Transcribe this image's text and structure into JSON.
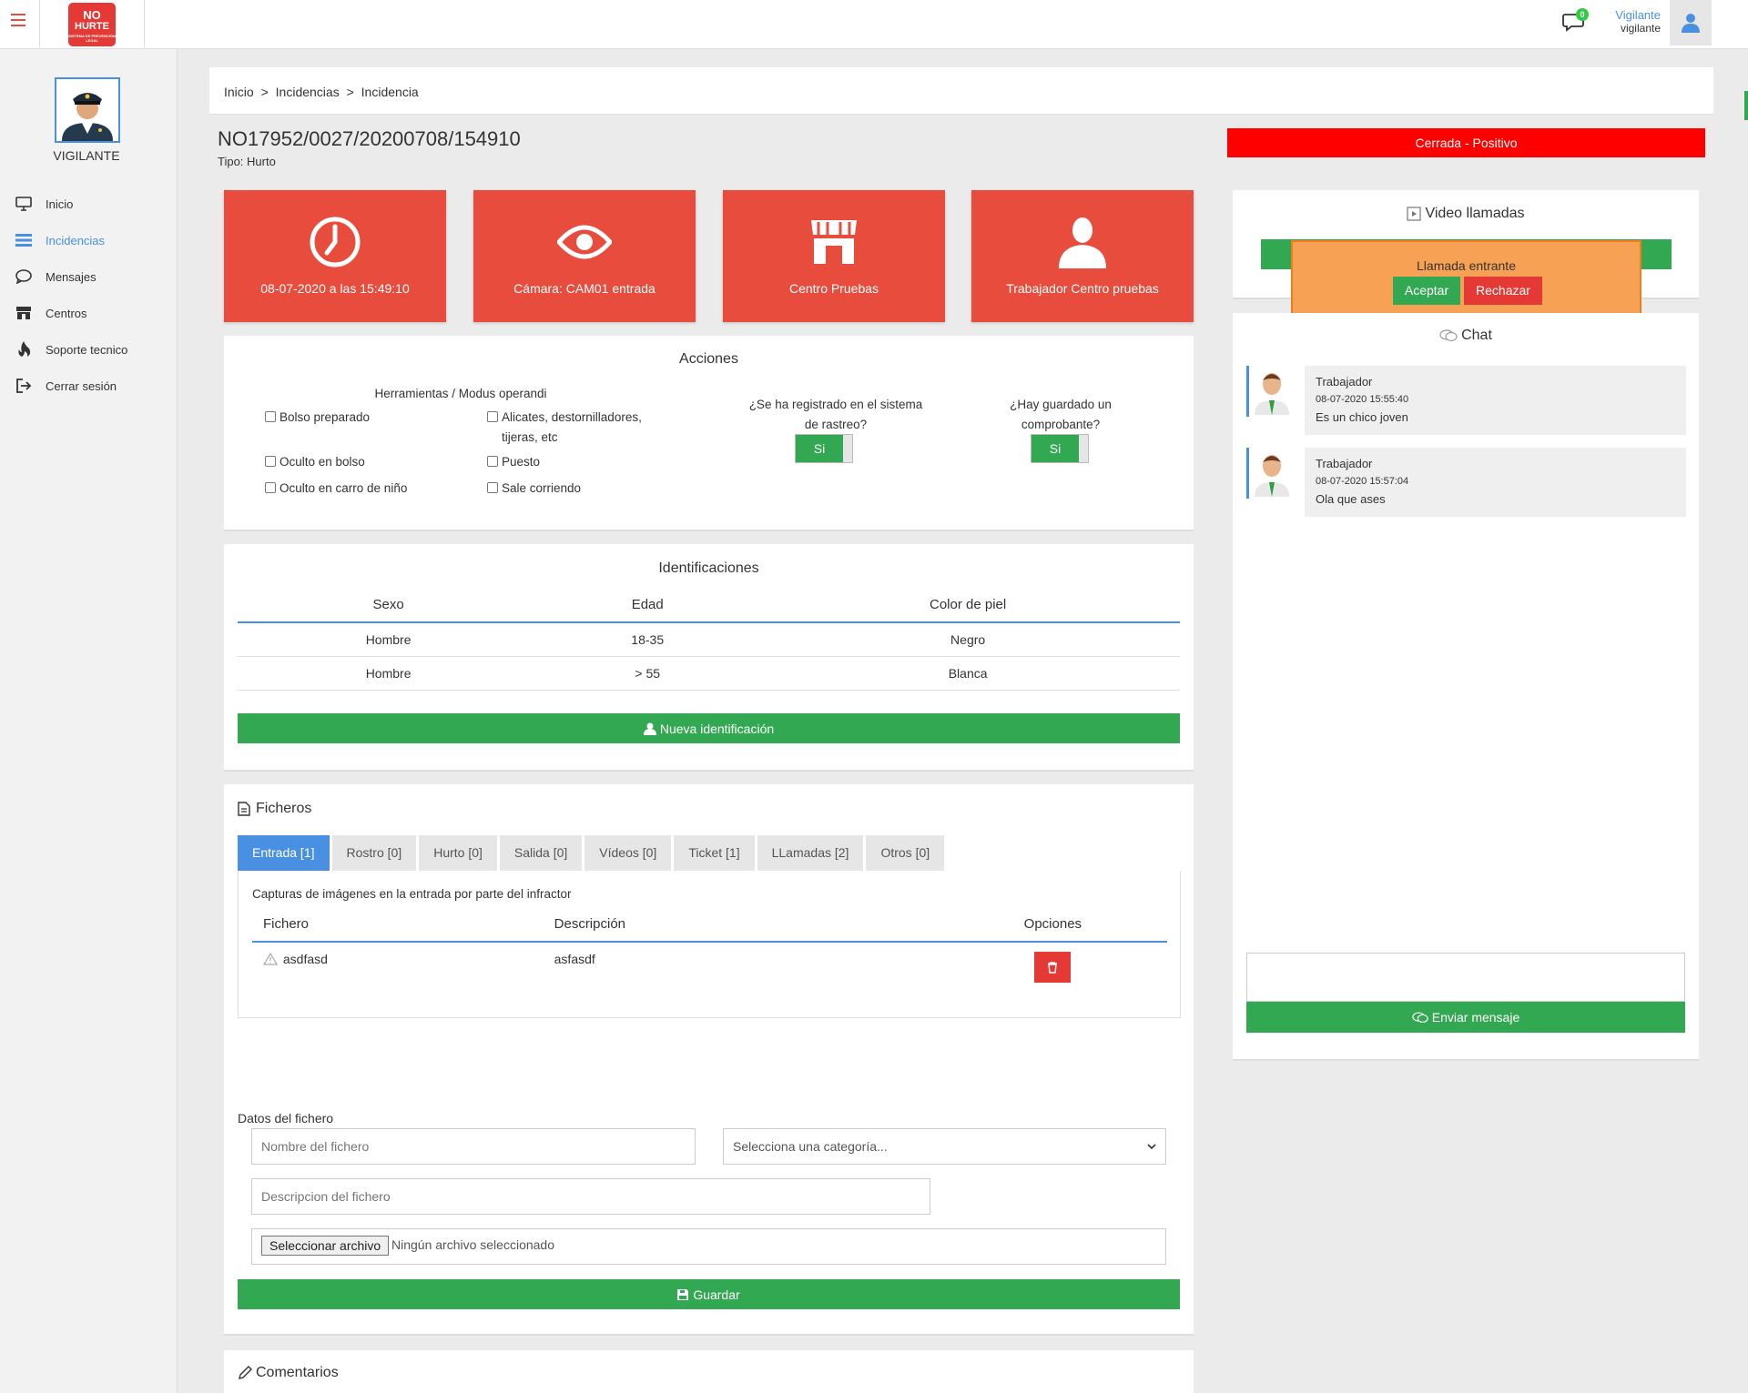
{
  "header": {
    "logo_top": "NO",
    "logo_main": "HURTE",
    "logo_sub": "SISTEMA DE PREVENCIÓN LEGAL",
    "notifications": "0",
    "user_name": "Vigilante",
    "user_role": "vigilante"
  },
  "sidebar": {
    "profile_label": "VIGILANTE",
    "items": [
      {
        "label": "Inicio",
        "icon": "monitor-icon"
      },
      {
        "label": "Incidencias",
        "icon": "list-icon"
      },
      {
        "label": "Mensajes",
        "icon": "message-icon"
      },
      {
        "label": "Centros",
        "icon": "store-icon"
      },
      {
        "label": "Soporte tecnico",
        "icon": "flame-icon"
      },
      {
        "label": "Cerrar sesión",
        "icon": "logout-icon"
      }
    ]
  },
  "breadcrumb": {
    "items": [
      "Inicio",
      "Incidencias",
      "Incidencia"
    ],
    "sep": ">"
  },
  "incident": {
    "code": "NO17952/0027/20200708/154910",
    "type": "Tipo: Hurto",
    "status": "Cerrada - Positivo",
    "status_color": "#ff0000"
  },
  "tiles": [
    {
      "label": "08-07-2020 a las 15:49:10",
      "icon": "clock-icon"
    },
    {
      "label": "Cámara: CAM01 entrada",
      "icon": "eye-icon"
    },
    {
      "label": "Centro Pruebas",
      "icon": "store-icon"
    },
    {
      "label": "Trabajador Centro pruebas",
      "icon": "person-icon"
    }
  ],
  "acciones": {
    "title": "Acciones",
    "tools_title": "Herramientas / Modus operandi",
    "checks": [
      "Bolso preparado",
      "Alicates, destornilladores, tijeras, etc",
      "Oculto en bolso",
      "Puesto",
      "Oculto en carro de niño",
      "Sale corriendo"
    ],
    "q1": "¿Se ha registrado en el sistema de rastreo?",
    "q1_value": "Si",
    "q2": "¿Hay guardado un comprobante?",
    "q2_value": "Si"
  },
  "identificaciones": {
    "title": "Identificaciones",
    "headers": [
      "Sexo",
      "Edad",
      "Color de piel"
    ],
    "rows": [
      [
        "Hombre",
        "18-35",
        "Negro"
      ],
      [
        "Hombre",
        "> 55",
        "Blanca"
      ]
    ],
    "button": "Nueva identificación"
  },
  "ficheros": {
    "title": "Ficheros",
    "tabs": [
      "Entrada [1]",
      "Rostro [0]",
      "Hurto [0]",
      "Salida [0]",
      "Vídeos [0]",
      "Ticket [1]",
      "LLamadas [2]",
      "Otros [0]"
    ],
    "description": "Capturas de imágenes en la entrada por parte del infractor",
    "headers": [
      "Fichero",
      "Descripción",
      "Opciones"
    ],
    "rows": [
      {
        "file": "asdfasd",
        "desc": "asfasdf"
      }
    ],
    "form_title": "Datos del fichero",
    "name_placeholder": "Nombre del fichero",
    "category_placeholder": "Selecciona una categoría...",
    "desc_placeholder": "Descripcion del fichero",
    "file_button": "Seleccionar archivo",
    "file_none": "Ningún archivo seleccionado",
    "save": "Guardar"
  },
  "comentarios": {
    "title": "Comentarios"
  },
  "video": {
    "title": "Video llamadas",
    "incoming": "Llamada entrante",
    "accept": "Aceptar",
    "reject": "Rechazar"
  },
  "chat": {
    "title": "Chat",
    "messages": [
      {
        "who": "Trabajador",
        "when": "08-07-2020 15:55:40",
        "text": "Es un chico joven"
      },
      {
        "who": "Trabajador",
        "when": "08-07-2020 15:57:04",
        "text": "Ola que ases"
      }
    ],
    "send": "Enviar mensaje"
  }
}
